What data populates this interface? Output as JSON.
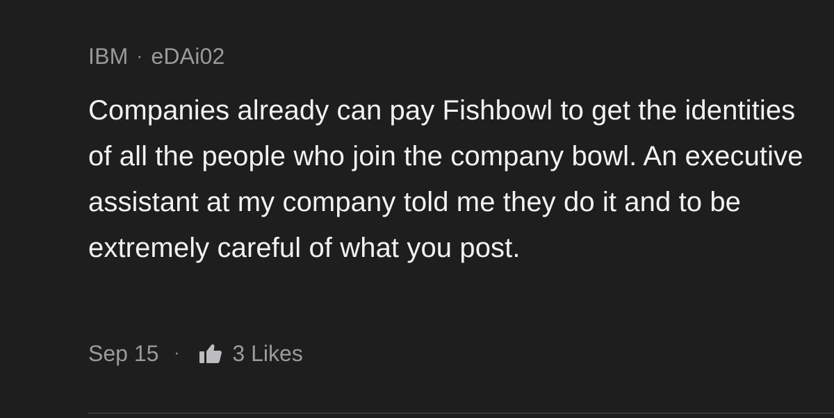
{
  "post": {
    "company": "IBM",
    "username": "eDAi02",
    "separator": "·",
    "text": "Companies already can pay Fishbowl to get the identities of all the people who join the company bowl. An executive assistant at my company told me they do it and to be extremely careful of what you post.",
    "date": "Sep 15",
    "likes_label": "3 Likes",
    "like_icon": "thumbs-up-icon"
  },
  "colors": {
    "background": "#1e1e1f",
    "primary_text": "#f2f2f2",
    "secondary_text": "#9b9b9d",
    "divider": "#38383a"
  }
}
